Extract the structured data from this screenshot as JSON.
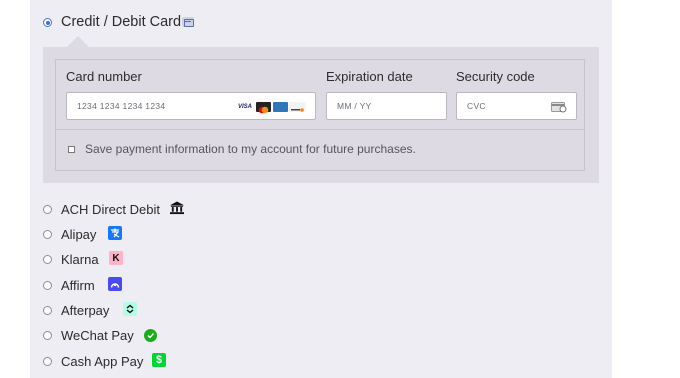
{
  "card_method": {
    "title": "Credit / Debit Card",
    "icon": "credit-card-icon",
    "fields": {
      "card_number": {
        "label": "Card number",
        "placeholder": "1234 1234 1234 1234",
        "brands": [
          "VISA",
          "mastercard",
          "AMEX",
          "DISCOVER"
        ]
      },
      "expiration": {
        "label": "Expiration date",
        "placeholder": "MM / YY"
      },
      "security": {
        "label": "Security code",
        "placeholder": "CVC",
        "icon": "cvc-card-icon"
      }
    },
    "save_label": "Save payment information to my account for future purchases.",
    "save_checked": false
  },
  "methods": [
    {
      "label": "ACH Direct Debit",
      "icon": "bank-icon"
    },
    {
      "label": "Alipay",
      "icon": "alipay-icon",
      "color": "#1677ff"
    },
    {
      "label": "Klarna",
      "icon": "klarna-icon",
      "color": "#ffb3c7"
    },
    {
      "label": "Affirm",
      "icon": "affirm-icon",
      "color": "#4a4af4"
    },
    {
      "label": "Afterpay",
      "icon": "afterpay-icon",
      "color": "#b2fce4"
    },
    {
      "label": "WeChat Pay",
      "icon": "wechat-pay-icon",
      "color": "#1aad19"
    },
    {
      "label": "Cash App Pay",
      "icon": "cash-app-icon",
      "color": "#00d632"
    }
  ]
}
